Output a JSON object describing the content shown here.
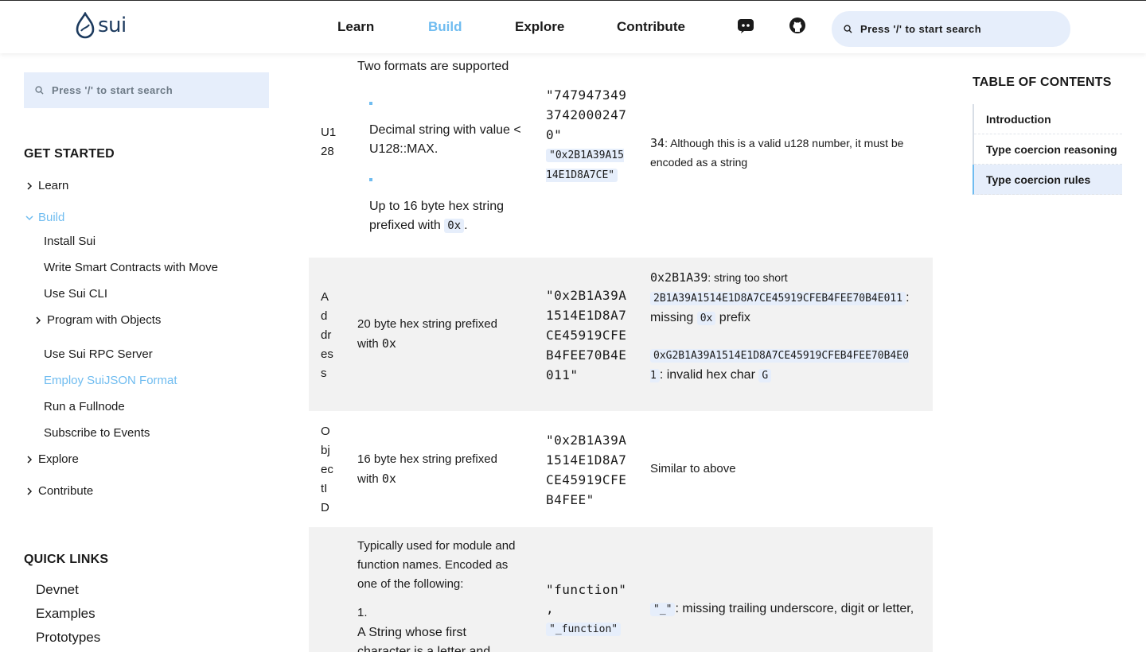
{
  "header": {
    "logo_text": "sui",
    "nav": [
      "Learn",
      "Build",
      "Explore",
      "Contribute"
    ],
    "active_nav": "Build",
    "icons": [
      "discord-icon",
      "github-icon",
      "search-icon"
    ],
    "search_placeholder": "Press '/' to start search"
  },
  "sidebar": {
    "search_placeholder": "Press '/' to start search",
    "get_started_title": "GET STARTED",
    "items": {
      "learn": "Learn",
      "build": "Build",
      "install": "Install Sui",
      "write": "Write Smart Contracts with Move",
      "cli": "Use Sui CLI",
      "program": "Program with Objects",
      "rpc": "Use Sui RPC Server",
      "json": "Employ SuiJSON Format",
      "fullnode": "Run a Fullnode",
      "events": "Subscribe to Events",
      "explore": "Explore",
      "contribute": "Contribute"
    },
    "quick_links_title": "QUICK LINKS",
    "quick_links": [
      "Devnet",
      "Examples",
      "Prototypes"
    ]
  },
  "table": {
    "u128": {
      "type": "U128",
      "desc_intro": "Two formats are supported",
      "bullet1": "Decimal string with value < U128::MAX.",
      "bullet2_pre": "Up to 16 byte hex string prefixed with ",
      "bullet2_code": "0x",
      "bullet2_post": ".",
      "valid_1": "\"7479473493742000247 0\"",
      "valid_2": "\"0x2B1A39A1514E1D8A7CE\"",
      "invalid_code": "34",
      "invalid_text": ": Although this is a valid u128 number, it must be encoded as a string"
    },
    "address": {
      "type": "Address",
      "desc_pre": "20 byte hex string prefixed with ",
      "desc_code": "0x",
      "valid": "\"0x2B1A39A1514E1D8A7CE45919CFEB4FEE70B4E011\"",
      "inv1_code": "0x2B1A39",
      "inv1_text": ": string too short",
      "inv2_code": "2B1A39A1514E1D8A7CE45919CFEB4FEE70B4E011",
      "inv2_text": ": missing ",
      "inv2_code2": "0x",
      "inv2_post": " prefix",
      "inv3_code": "0xG2B1A39A1514E1D8A7CE45919CFEB4FEE70B4E01",
      "inv3_text": ": invalid hex char ",
      "inv3_code2": "G"
    },
    "objectid": {
      "type": "ObjectID",
      "desc_pre": "16 byte hex string prefixed with ",
      "desc_code": "0x",
      "valid": "\"0x2B1A39A1514E1D8A7CE45919CFEB4FEE\"",
      "invalid": "Similar to above"
    },
    "identifier": {
      "desc_intro": "Typically used for module and function names. Encoded as one of the following:",
      "list_num": "1.",
      "list_text": "A String whose first character is a letter and",
      "valid_1": "\"function\"",
      "valid_sep": ",",
      "valid_2": "\"_function\"",
      "invalid_code": "\"_\"",
      "invalid_text": ": missing trailing underscore, digit or letter,"
    }
  },
  "toc": {
    "title": "TABLE OF CONTENTS",
    "items": [
      "Introduction",
      "Type coercion reasoning",
      "Type coercion rules"
    ],
    "active": "Type coercion rules"
  }
}
